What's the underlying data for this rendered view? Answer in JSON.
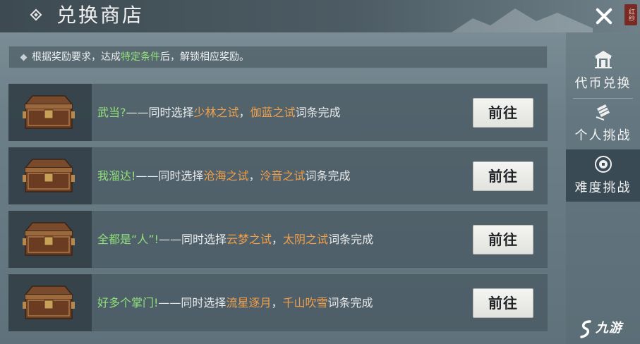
{
  "header": {
    "title": "兑换商店",
    "seal_text": "红纱"
  },
  "notice": {
    "part1": "根据奖励要求，达成",
    "highlight": "特定条件",
    "part2": "后，解锁相应奖励。"
  },
  "tasks": [
    {
      "name": "武当?",
      "dash": "——同时选择",
      "item1": "少林之试",
      "comma": "，",
      "item2": "伽蓝之试",
      "suffix": "词条完成",
      "button": "前往"
    },
    {
      "name": "我溜达!",
      "dash": "——同时选择",
      "item1": "沧海之试",
      "comma": "，",
      "item2": "泠音之试",
      "suffix": "词条完成",
      "button": "前往"
    },
    {
      "name": "全都是“人”!",
      "dash": "——同时选择",
      "item1": "云梦之试",
      "comma": "，",
      "item2": "太阴之试",
      "suffix": "词条完成",
      "button": "前往"
    },
    {
      "name": "好多个掌门!",
      "dash": "——同时选择",
      "item1": "流星逐月",
      "comma": "，",
      "item2": "千山吹雪",
      "suffix": "词条完成",
      "button": "前往"
    }
  ],
  "tabs": [
    {
      "label": "代币兑换",
      "icon": "pavilion-icon",
      "active": false
    },
    {
      "label": "个人挑战",
      "icon": "scroll-icon",
      "active": false
    },
    {
      "label": "难度挑战",
      "icon": "coin-icon",
      "active": true
    }
  ],
  "watermark": {
    "text": "九游"
  },
  "colors": {
    "highlight_green": "#8fe07a",
    "highlight_orange": "#f0a04a",
    "active_tab": "#3a4a54"
  }
}
